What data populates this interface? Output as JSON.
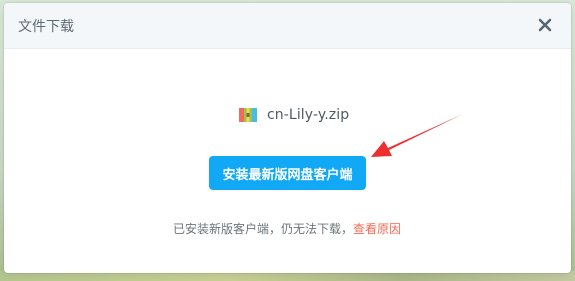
{
  "dialog": {
    "title": "文件下载",
    "close_icon": "close-icon"
  },
  "file": {
    "name": "cn-Lily-y.zip",
    "icon": "archive-file-icon"
  },
  "actions": {
    "install_label": "安装最新版网盘客户端"
  },
  "hint": {
    "text": "已安装新版客户端，仍无法下载，",
    "link_label": "查看原因"
  },
  "colors": {
    "accent": "#11a8f6",
    "link": "#f36b55",
    "arrow": "#ef2f2f"
  }
}
